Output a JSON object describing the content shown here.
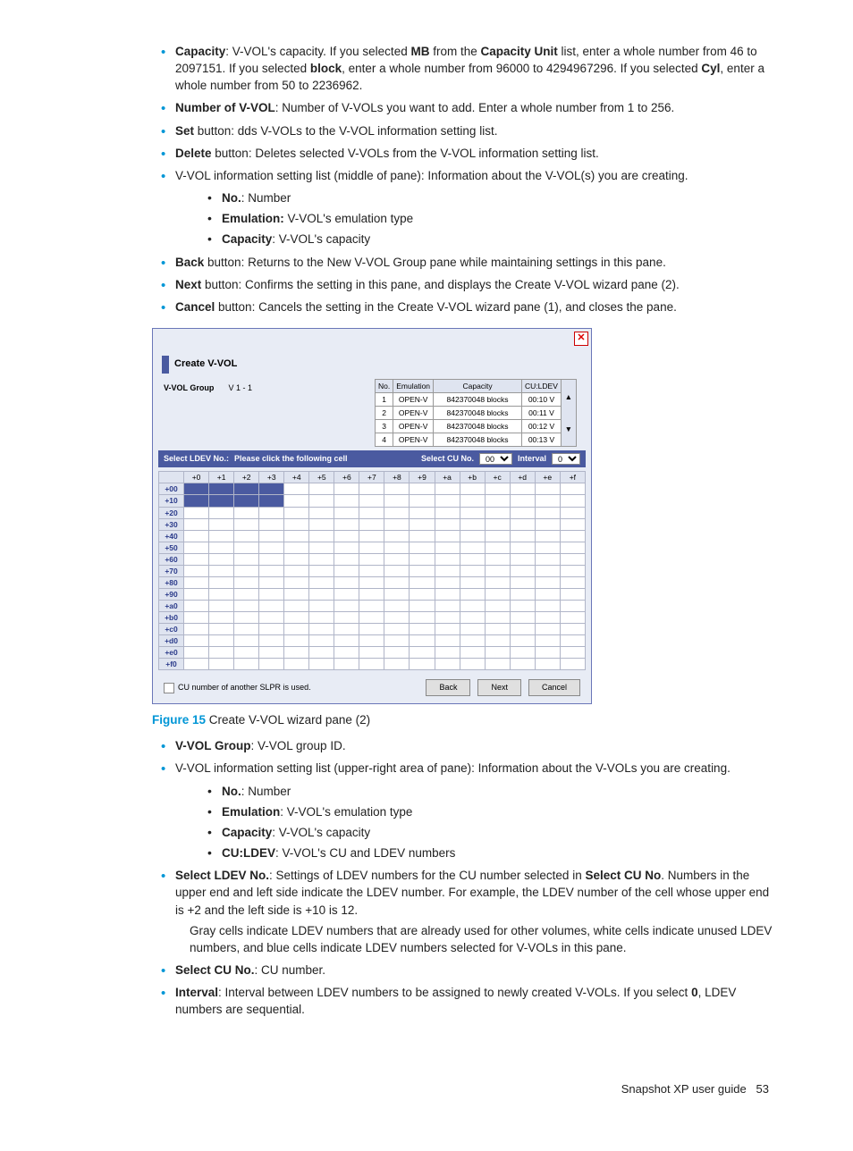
{
  "bullets_top": {
    "capacity_a": "Capacity",
    "capacity_t1": ": V-VOL's capacity. If you selected ",
    "capacity_b1": "MB",
    "capacity_t2": " from the ",
    "capacity_b2": "Capacity Unit",
    "capacity_t3": " list, enter a whole number from 46 to 2097151. If you selected ",
    "capacity_b3": "block",
    "capacity_t4": ", enter a whole number from 96000 to 4294967296. If you selected ",
    "capacity_b4": "Cyl",
    "capacity_t5": ", enter a whole number from 50 to 2236962.",
    "numvvol_b": "Number of V-VOL",
    "numvvol_t": ": Number of V-VOLs you want to add. Enter a whole number from 1 to 256.",
    "set_b": "Set",
    "set_t": " button: dds V-VOLs to the V-VOL information setting list.",
    "del_b": "Delete",
    "del_t": " button: Deletes selected V-VOLs from the V-VOL information setting list.",
    "info_t": "V-VOL information setting list (middle of pane): Information about the V-VOL(s) you are creating.",
    "info_no_b": "No.",
    "info_no_t": ": Number",
    "info_em_b": "Emulation:",
    "info_em_t": " V-VOL's emulation type",
    "info_cap_b": "Capacity",
    "info_cap_t": ": V-VOL's capacity",
    "back_b": "Back",
    "back_t": " button: Returns to the New V-VOL Group pane while maintaining settings in this pane.",
    "next_b": "Next",
    "next_t": " button: Confirms the setting in this pane, and displays the Create V-VOL wizard pane (2).",
    "cancel_b": "Cancel",
    "cancel_t": " button: Cancels the setting in the Create V-VOL wizard pane (1), and closes the pane."
  },
  "dialog": {
    "title": "Create V-VOL",
    "vvol_group_label": "V-VOL Group",
    "vvol_group_value": "V 1 - 1",
    "mini_headers": [
      "No.",
      "Emulation",
      "Capacity",
      "CU:LDEV"
    ],
    "mini_rows": [
      [
        "1",
        "OPEN-V",
        "842370048 blocks",
        "00:10 V"
      ],
      [
        "2",
        "OPEN-V",
        "842370048 blocks",
        "00:11 V"
      ],
      [
        "3",
        "OPEN-V",
        "842370048 blocks",
        "00:12 V"
      ],
      [
        "4",
        "OPEN-V",
        "842370048 blocks",
        "00:13 V"
      ]
    ],
    "bar_select_ldev": "Select LDEV No.:",
    "bar_please": "Please click the following cell",
    "bar_select_cu": "Select CU No.",
    "bar_cu_val": "00",
    "bar_interval": "Interval",
    "bar_interval_val": "0",
    "grid_cols": [
      "+0",
      "+1",
      "+2",
      "+3",
      "+4",
      "+5",
      "+6",
      "+7",
      "+8",
      "+9",
      "+a",
      "+b",
      "+c",
      "+d",
      "+e",
      "+f"
    ],
    "grid_rows": [
      "+00",
      "+10",
      "+20",
      "+30",
      "+40",
      "+50",
      "+60",
      "+70",
      "+80",
      "+90",
      "+a0",
      "+b0",
      "+c0",
      "+d0",
      "+e0",
      "+f0"
    ],
    "checkbox_label": "CU number of another SLPR is used.",
    "btn_back": "Back",
    "btn_next": "Next",
    "btn_cancel": "Cancel"
  },
  "figcap": {
    "num": "Figure 15",
    "text": " Create V-VOL wizard pane (2)"
  },
  "bullets_bottom": {
    "vvolg_b": "V-VOL Group",
    "vvolg_t": ": V-VOL group ID.",
    "info_t": "V-VOL information setting list (upper-right area of pane): Information about the V-VOLs you are creating.",
    "no_b": "No.",
    "no_t": ": Number",
    "em_b": "Emulation",
    "em_t": ": V-VOL's emulation type",
    "cap_b": "Capacity",
    "cap_t": ": V-VOL's capacity",
    "cu_b": "CU:LDEV",
    "cu_t": ": V-VOL's CU and LDEV numbers",
    "selldev_b": "Select LDEV No.",
    "selldev_t1": ": Settings of LDEV numbers for the CU number selected in ",
    "selldev_b2": "Select CU No",
    "selldev_t2": ". Numbers in the upper end and left side indicate the LDEV number. For example, the LDEV number of the cell whose upper end is +2 and the left side is +10 is 12.",
    "selldev_p2": "Gray cells indicate LDEV numbers that are already used for other volumes, white cells indicate unused LDEV numbers, and blue cells indicate LDEV numbers selected for V-VOLs in this pane.",
    "selcu_b": "Select CU No.",
    "selcu_t": ": CU number.",
    "interval_b": "Interval",
    "interval_t1": ": Interval between LDEV numbers to be assigned to newly created V-VOLs. If you select ",
    "interval_b2": "0",
    "interval_t2": ", LDEV numbers are sequential."
  },
  "footer": {
    "text": "Snapshot XP user guide",
    "page": "53"
  }
}
